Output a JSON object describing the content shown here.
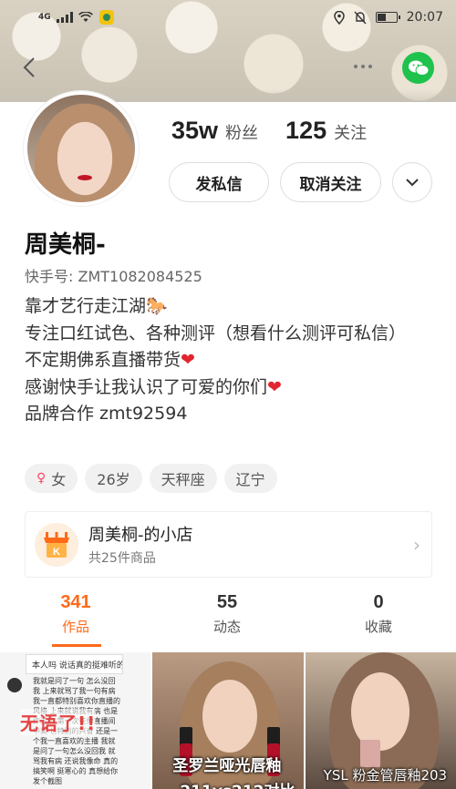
{
  "status_bar": {
    "network": "4G",
    "time": "20:07"
  },
  "profile": {
    "followers_count": "35w",
    "followers_label": "粉丝",
    "following_count": "125",
    "following_label": "关注",
    "message_button": "发私信",
    "unfollow_button": "取消关注",
    "username": "周美桐-",
    "user_id": "快手号: ZMT1082084525",
    "bio_lines": [
      "靠才艺行走江湖🐎",
      "专注口红试色、各种测评（想看什么测评可私信）",
      "不定期佛系直播带货",
      "感谢快手让我认识了可爱的你们",
      "品牌合作 zmt92594"
    ],
    "tags": [
      "女",
      "26岁",
      "天秤座",
      "辽宁"
    ]
  },
  "shop": {
    "name": "周美桐-的小店",
    "count": "共25件商品"
  },
  "tabs": [
    {
      "count": "341",
      "label": "作品"
    },
    {
      "count": "55",
      "label": "动态"
    },
    {
      "count": "0",
      "label": "收藏"
    }
  ],
  "grid": {
    "tile1_header": "本人吗 说话真的挺难听的啊",
    "tile1_text": "我就是问了一句 怎么没回我 上来就骂了我一句有病 我一直都特别喜欢你直播的风格 上来就说我有病 也是作过奖 第一次在你直播间中奖 也特别的兴奋 还是一个我一直喜欢的主播 我就是问了一句怎么没回我 就骂我有病 还说我像命 真的搞笑啊 挺寒心的 真想给你发个截图",
    "tile1_caption": "无语了!!",
    "tile2_caption": "圣罗兰哑光唇釉",
    "tile2_caption2": "211vs212对比",
    "tile3_caption": "YSL 粉金管唇釉203"
  },
  "colors": {
    "accent": "#ff6a19",
    "heart": "#e0262f",
    "wechat": "#1fc24d"
  }
}
